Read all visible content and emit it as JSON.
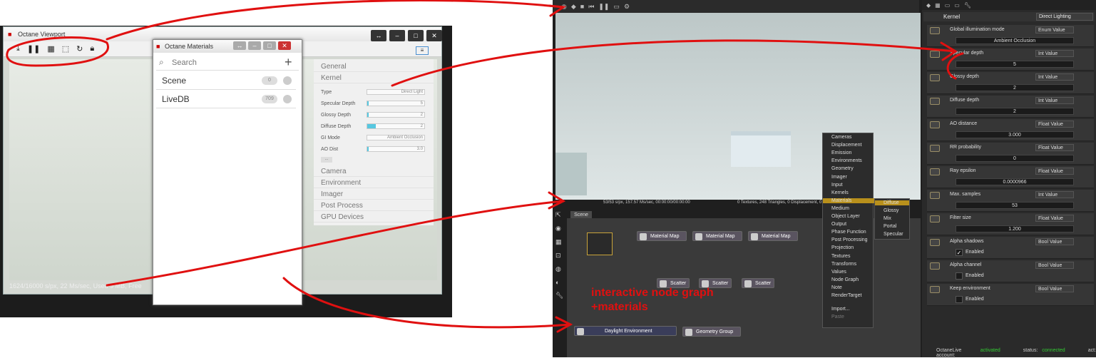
{
  "left": {
    "viewport_title": "Octane Viewport",
    "viewport_status": "1624/16000 s/px, 22 Ms/sec, Used 9 MB, Free",
    "materials_title": "Octane Materials",
    "search_placeholder": "Search",
    "materials": [
      {
        "label": "Scene",
        "count": "0"
      },
      {
        "label": "LiveDB",
        "count": "709"
      }
    ],
    "sections_top": [
      "General",
      "Kernel"
    ],
    "sections_bottom": [
      "Camera",
      "Environment",
      "Imager",
      "Post Process",
      "GPU Devices"
    ],
    "kernel_rows": [
      {
        "label": "Type",
        "value": "Direct Light",
        "fill": 0
      },
      {
        "label": "Specular Depth",
        "value": "5",
        "fill": 0.03
      },
      {
        "label": "Glossy Depth",
        "value": "2",
        "fill": 0.03
      },
      {
        "label": "Diffuse Depth",
        "value": "2",
        "fill": 0.15
      },
      {
        "label": "GI Mode",
        "value": "Ambient Occlusion",
        "fill": 0
      },
      {
        "label": "AO Dist",
        "value": "3.0",
        "fill": 0.03
      }
    ],
    "more_label": "..."
  },
  "right": {
    "scene_tab": "Scene",
    "status_left": "53/53 s/px, 157.57 Ms/sec, 00:00:00/00:00:00",
    "status_right": "0 Textures, 248 Triangles, 0 Displacement, 0",
    "nodes": [
      {
        "label": "Material Map"
      },
      {
        "label": "Material Map"
      },
      {
        "label": "Material Map"
      },
      {
        "label": "Scatter"
      },
      {
        "label": "Scatter"
      },
      {
        "label": "Scatter"
      },
      {
        "label": "Daylight Environment"
      },
      {
        "label": "Geometry Group"
      }
    ],
    "context_menu": [
      "Cameras",
      "Displacement",
      "Emission",
      "Environments",
      "Geometry",
      "Imager",
      "Input",
      "Kernels",
      "Materials",
      "Medium",
      "Object Layer",
      "Output",
      "Phase Function",
      "Post Processing",
      "Projection",
      "Textures",
      "Transforms",
      "Values",
      "Node Graph",
      "Note",
      "RenderTarget",
      "Import...",
      "Paste"
    ],
    "submenu": [
      "Diffuse",
      "Glossy",
      "Mix",
      "Portal",
      "Specular"
    ],
    "kernel": {
      "title": "Kernel",
      "type": "Direct Lighting",
      "items": [
        {
          "label": "Global illumination mode",
          "type": "Enum Value",
          "value": "Ambient Occlusion"
        },
        {
          "label": "Specular depth",
          "type": "Int Value",
          "value": "5"
        },
        {
          "label": "Glossy depth",
          "type": "Int Value",
          "value": "2"
        },
        {
          "label": "Diffuse depth",
          "type": "Int Value",
          "value": "2"
        },
        {
          "label": "AO distance",
          "type": "Float Value",
          "value": "3.000"
        },
        {
          "label": "RR probability",
          "type": "Float Value",
          "value": "0"
        },
        {
          "label": "Ray epsilon",
          "type": "Float Value",
          "value": "0.0000966"
        },
        {
          "label": "Max. samples",
          "type": "Int Value",
          "value": "53"
        },
        {
          "label": "Filter size",
          "type": "Float Value",
          "value": "1.200"
        },
        {
          "label": "Alpha shadows",
          "type": "Bool Value",
          "value": "Enabled",
          "checked": true
        },
        {
          "label": "Alpha channel",
          "type": "Bool Value",
          "value": "Enabled",
          "checked": false
        },
        {
          "label": "Keep environment",
          "type": "Bool Value",
          "value": "Enabled",
          "checked": false
        }
      ]
    },
    "account": {
      "label": "OctaneLive account:",
      "acct_state": "activated",
      "status_label": "status:",
      "status_state": "connected",
      "act_label": "act:"
    }
  },
  "annotation": [
    "interactive node graph",
    "+materials"
  ],
  "colors": {
    "annotation_red": "#e01010",
    "accent_cyan": "#57c7e0",
    "menu_highlight": "#b8901c"
  }
}
